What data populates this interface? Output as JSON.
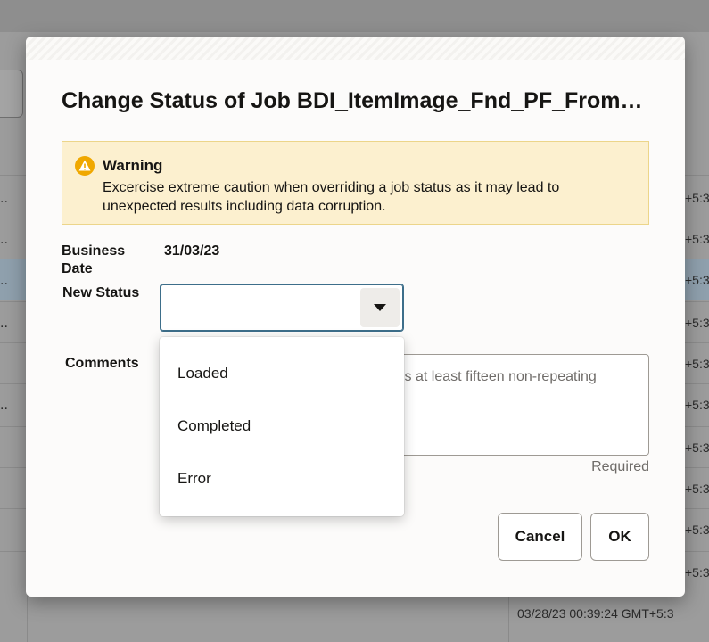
{
  "background": {
    "row_ellipsis": "..",
    "timezone_fragment": "+5:3",
    "bottom_timestamp": "03/28/23 00:39:24 GMT+5:3"
  },
  "dialog": {
    "title": "Change Status of Job BDI_ItemImage_Fnd_PF_From_...",
    "warning": {
      "heading": "Warning",
      "text": "Excercise extreme caution when overriding a job status as it may lead to unexpected results including data corruption.",
      "icon": "warning-triangle-icon",
      "color": "#f0a800"
    },
    "business_date": {
      "label": "Business Date",
      "value": "31/03/23"
    },
    "new_status": {
      "label": "New Status",
      "value": "",
      "options": [
        "Loaded",
        "Completed",
        "Error"
      ]
    },
    "comments": {
      "label": "Comments",
      "visible_placeholder_fragment": "is at least fifteen non-repeating",
      "required_text": "Required"
    },
    "buttons": {
      "cancel": "Cancel",
      "ok": "OK"
    }
  }
}
